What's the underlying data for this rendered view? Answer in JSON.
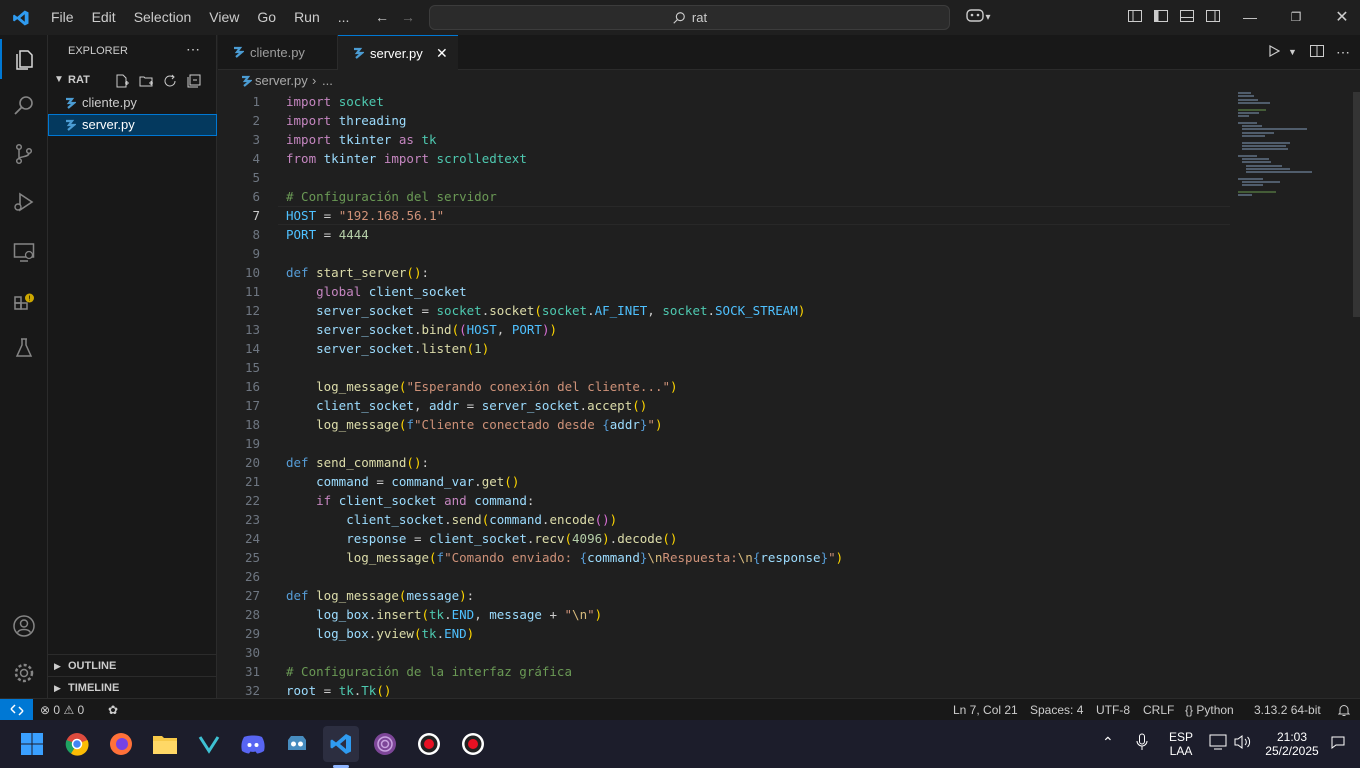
{
  "titlebar": {
    "menu": [
      "File",
      "Edit",
      "Selection",
      "View",
      "Go",
      "Run",
      "..."
    ],
    "search_text": "rat"
  },
  "sidebar": {
    "header": "EXPLORER",
    "folder": "RAT",
    "files": [
      "cliente.py",
      "server.py"
    ],
    "outline": "OUTLINE",
    "timeline": "TIMELINE"
  },
  "tabs": [
    {
      "label": "cliente.py",
      "active": false
    },
    {
      "label": "server.py",
      "active": true
    }
  ],
  "breadcrumb": {
    "file": "server.py",
    "rest": "..."
  },
  "editor": {
    "line_numbers": [
      "1",
      "2",
      "3",
      "4",
      "5",
      "6",
      "7",
      "8",
      "9",
      "10",
      "11",
      "12",
      "13",
      "14",
      "15",
      "16",
      "17",
      "18",
      "19",
      "20",
      "21",
      "22",
      "23",
      "24",
      "25",
      "26",
      "27",
      "28",
      "29",
      "30",
      "31",
      "32"
    ],
    "current_line": "7",
    "lines": [
      "import socket",
      "import threading",
      "import tkinter as tk",
      "from tkinter import scrolledtext",
      "",
      "# Configuración del servidor",
      "HOST = \"192.168.56.1\"",
      "PORT = 4444",
      "",
      "def start_server():",
      "    global client_socket",
      "    server_socket = socket.socket(socket.AF_INET, socket.SOCK_STREAM)",
      "    server_socket.bind((HOST, PORT))",
      "    server_socket.listen(1)",
      "",
      "    log_message(\"Esperando conexión del cliente...\")",
      "    client_socket, addr = server_socket.accept()",
      "    log_message(f\"Cliente conectado desde {addr}\")",
      "",
      "def send_command():",
      "    command = command_var.get()",
      "    if client_socket and command:",
      "        client_socket.send(command.encode())",
      "        response = client_socket.recv(4096).decode()",
      "        log_message(f\"Comando enviado: {command}\\nRespuesta:\\n{response}\")",
      "",
      "def log_message(message):",
      "    log_box.insert(tk.END, message + \"\\n\")",
      "    log_box.yview(tk.END)",
      "",
      "# Configuración de la interfaz gráfica",
      "root = tk.Tk()"
    ]
  },
  "statusbar": {
    "errors": "0",
    "warnings": "0",
    "position": "Ln 7, Col 21",
    "spaces": "Spaces: 4",
    "encoding": "UTF-8",
    "eol": "CRLF",
    "language": "Python",
    "interpreter": "3.13.2 64-bit"
  },
  "taskbar": {
    "lang": "ESP",
    "lang_sub": "LAA",
    "time": "21:03",
    "date": "25/2/2025"
  },
  "colors": {
    "accent": "#0078d4",
    "editor_bg": "#1f1f1f",
    "sidebar_bg": "#181818",
    "selected": "#04395e"
  }
}
